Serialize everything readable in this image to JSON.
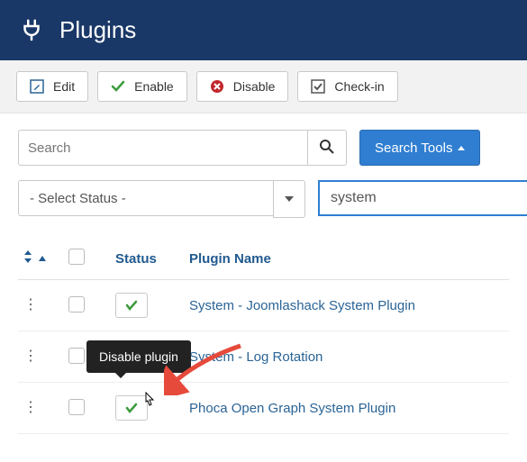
{
  "header": {
    "title": "Plugins"
  },
  "toolbar": {
    "edit": "Edit",
    "enable": "Enable",
    "disable": "Disable",
    "checkin": "Check-in"
  },
  "search": {
    "placeholder": "Search",
    "toolsLabel": "Search Tools"
  },
  "filters": {
    "statusLabel": "- Select Status -",
    "filterValue": "system"
  },
  "tableHeaders": {
    "status": "Status",
    "pluginName": "Plugin Name"
  },
  "rows": [
    {
      "name": "System - Joomlashack System Plugin",
      "enabled": true
    },
    {
      "name": "System - Log Rotation",
      "enabled": true
    },
    {
      "name": "Phoca Open Graph System Plugin",
      "enabled": true
    }
  ],
  "tooltip": "Disable plugin"
}
